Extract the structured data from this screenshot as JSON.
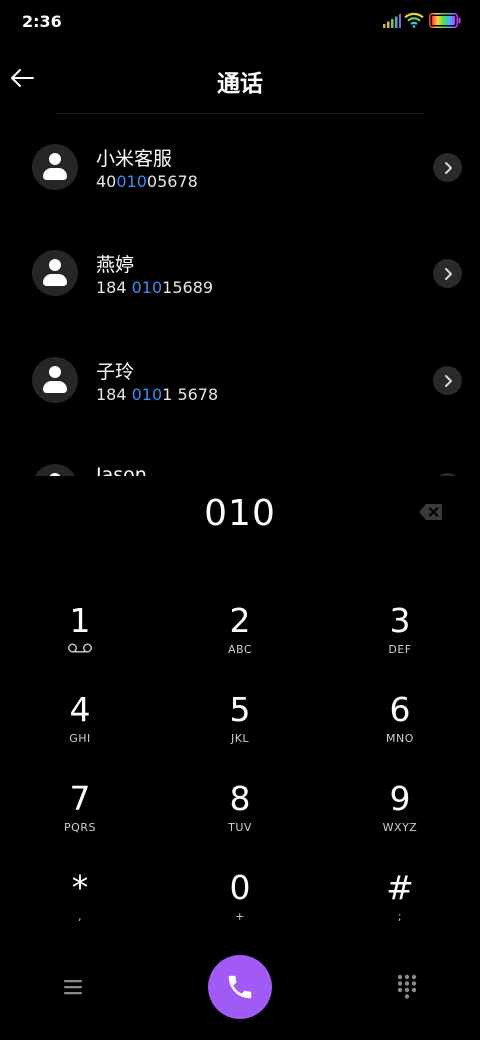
{
  "status_bar": {
    "time": "2:36"
  },
  "header": {
    "title": "通话"
  },
  "contacts": [
    {
      "name": "小米客服",
      "number_parts": [
        "40",
        "010",
        "05678"
      ]
    },
    {
      "name": "燕婷",
      "number_parts": [
        "184 ",
        "010",
        "15689"
      ]
    },
    {
      "name": "子玲",
      "number_parts": [
        "184 ",
        "010",
        "1 5678"
      ]
    },
    {
      "name": "Jason",
      "number_parts": [
        "",
        "",
        ""
      ]
    }
  ],
  "dialer": {
    "dialed_number": "010"
  },
  "keypad": [
    {
      "digit": "1",
      "letters": ""
    },
    {
      "digit": "2",
      "letters": "ABC"
    },
    {
      "digit": "3",
      "letters": "DEF"
    },
    {
      "digit": "4",
      "letters": "GHI"
    },
    {
      "digit": "5",
      "letters": "JKL"
    },
    {
      "digit": "6",
      "letters": "MNO"
    },
    {
      "digit": "7",
      "letters": "PQRS"
    },
    {
      "digit": "8",
      "letters": "TUV"
    },
    {
      "digit": "9",
      "letters": "WXYZ"
    },
    {
      "digit": "*",
      "letters": ","
    },
    {
      "digit": "0",
      "letters": "+"
    },
    {
      "digit": "#",
      "letters": ";"
    }
  ],
  "icons": {
    "back": "arrow-left-icon",
    "voicemail": "voicemail-icon",
    "backspace": "backspace-icon",
    "menu": "menu-icon",
    "call": "phone-icon",
    "keypad_toggle": "dialpad-icon"
  },
  "colors": {
    "accent": "#a25af6",
    "highlight": "#3b8ef0",
    "background": "#000000"
  }
}
